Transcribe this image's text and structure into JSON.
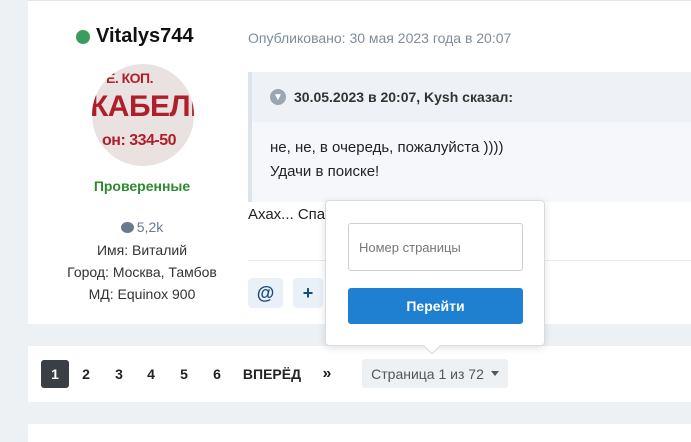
{
  "author": {
    "name": "Vitalys744",
    "status_color": "#3b9c5f",
    "avatar_lines": [
      "Е. КОП.",
      "КАБЕЛЬ",
      "он: 334-50"
    ],
    "group": "Проверенные",
    "posts_count": "5,2k",
    "info": [
      "Имя: Виталий",
      "Город: Москва, Тамбов",
      "МД: Equinox 900"
    ]
  },
  "post": {
    "published": "Опубликовано: 30 мая 2023 года в 20:07",
    "quote": {
      "header": "30.05.2023 в 20:07, Kysh сказал:",
      "lines": [
        "не, не, в очередь, пожалуйста ))))",
        "Удачи в поиске!"
      ]
    },
    "reply_text": "Ахах... Спа",
    "actions": [
      {
        "label": "@",
        "icon": "mention-icon"
      },
      {
        "label": "+",
        "icon": "plus-icon"
      }
    ]
  },
  "pagination": {
    "pages": [
      "1",
      "2",
      "3",
      "4",
      "5",
      "6"
    ],
    "current": "1",
    "next_label": "ВПЕРЁД",
    "last_label": "»",
    "page_indicator": "Страница 1 из 72"
  },
  "goto_popup": {
    "input_placeholder": "Номер страницы",
    "input_value": "",
    "button_label": "Перейти",
    "button_color": "#1f7fd1"
  }
}
